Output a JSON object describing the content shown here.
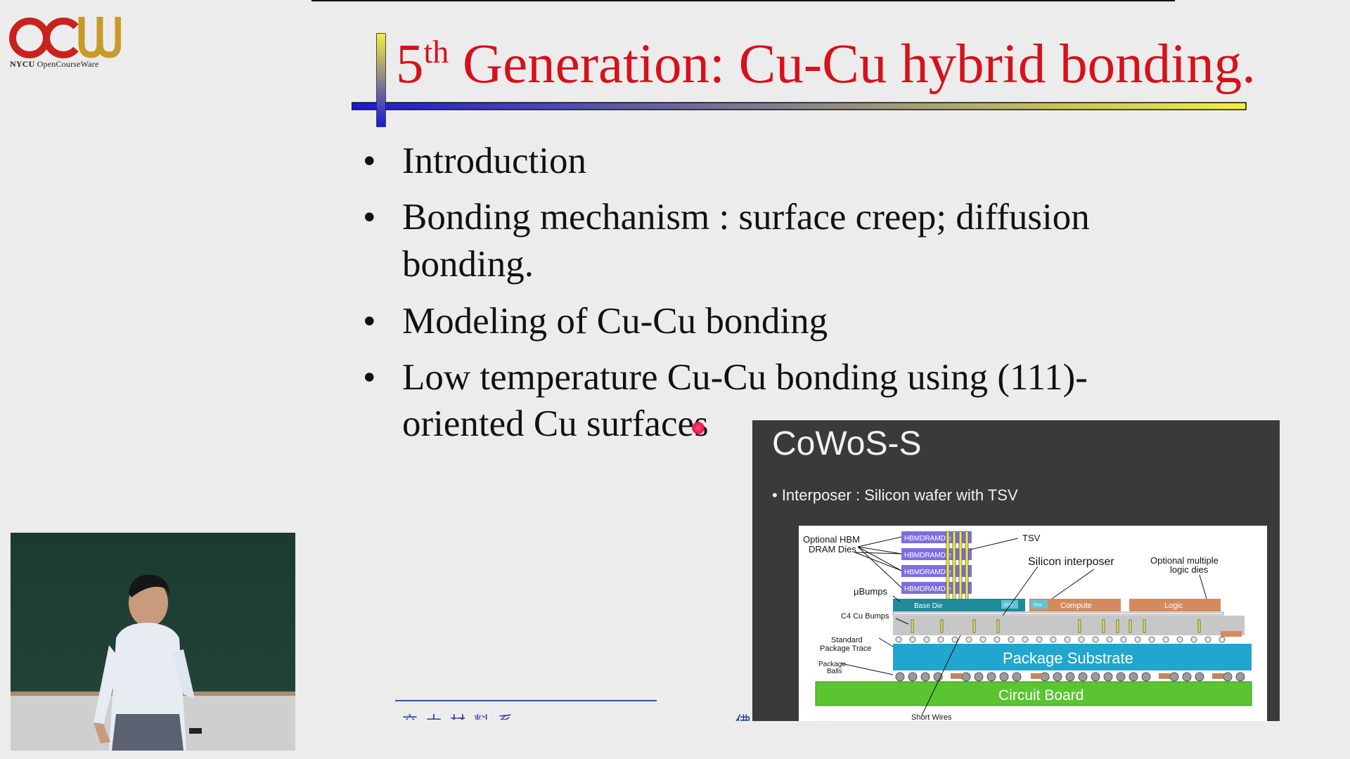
{
  "logo": {
    "letters": "OCW",
    "caption_bold": "NYCU",
    "caption_rest": " OpenCourseWare"
  },
  "slide": {
    "title_sup_num": "5",
    "title_sup": "th",
    "title_rest": " Generation: Cu-Cu hybrid bonding.",
    "bullets": [
      {
        "line1": "Introduction",
        "line2": ""
      },
      {
        "line1": "Bonding mechanism : surface creep; diffusion",
        "line2": "bonding."
      },
      {
        "line1": "Modeling of Cu-Cu bonding",
        "line2": ""
      },
      {
        "line1": "Low temperature Cu-Cu bonding using (111)-",
        "line2": "oriented Cu surfaces"
      }
    ],
    "footer_cut_text": "交大材料系",
    "footer_cut_text_2": "佛"
  },
  "cowos": {
    "title": "CoWoS-S",
    "bullet": "• Interposer : Silicon wafer with TSV",
    "diagram": {
      "optional_hbm": "Optional HBM",
      "dram_dies": "DRAM Dies",
      "hbm_label": "HBMDRAMDie",
      "tsv": "TSV",
      "silicon_interposer": "Silicon interposer",
      "optional_multiple": "Optional multiple",
      "logic_dies": "logic dies",
      "ubumps": "µBumps",
      "base_die": "Base Die",
      "phy": "PHY",
      "compute": "Compute",
      "logic": "Logic",
      "c4_bumps": "C4 Cu Bumps",
      "standard": "Standard",
      "package_trace": "Package Trace",
      "package": "Package",
      "balls": "Balls",
      "package_substrate": "Package Substrate",
      "circuit_board": "Circuit Board",
      "short_wires": "Short Wires"
    }
  },
  "colors": {
    "title_red": "#d6111b",
    "logo_red": "#c9221e",
    "logo_gold": "#c89a2a",
    "hbm_purple": "#7b6fe0",
    "base_teal": "#1e8a9a",
    "die_orange": "#d58a5e",
    "interposer_gray": "#c7c7c7",
    "substrate_blue": "#20a6cf",
    "board_green": "#5ac531"
  }
}
